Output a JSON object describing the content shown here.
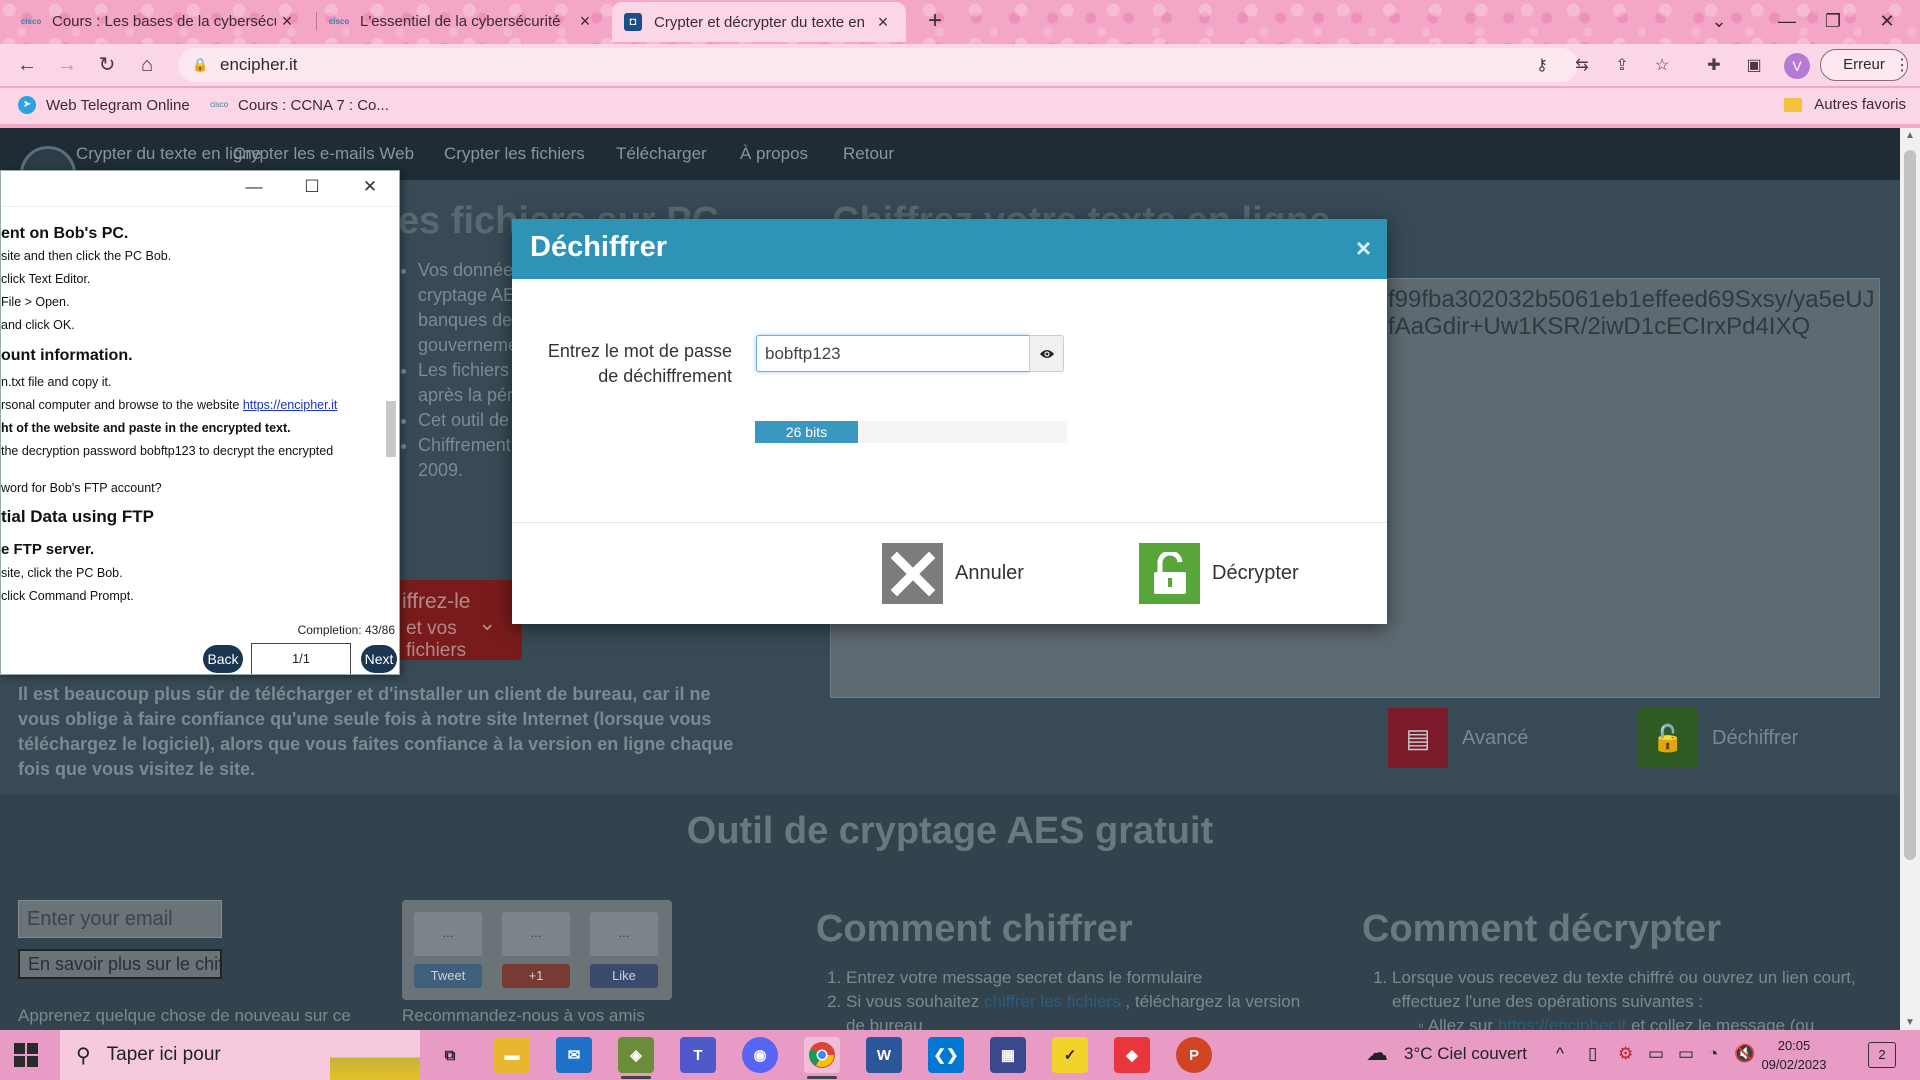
{
  "browser": {
    "tabs": [
      {
        "title": "Cours : Les bases de la cybersécu",
        "favicon": "cisco-icon",
        "active": false
      },
      {
        "title": "L'essentiel de la cybersécurité",
        "favicon": "cisco-icon",
        "active": false
      },
      {
        "title": "Crypter et décrypter du texte en",
        "favicon": "encipher-icon",
        "active": true
      }
    ],
    "url": "encipher.it",
    "profile_initial": "V",
    "error_label": "Erreur",
    "bookmarks": [
      {
        "label": "Web Telegram Online",
        "icon": "telegram-icon"
      },
      {
        "label": "Cours : CCNA 7 : Co...",
        "icon": "cisco-icon"
      }
    ],
    "other_bookmarks": "Autres favoris"
  },
  "site": {
    "nav": [
      "Crypter du texte en ligne",
      "Crypter les e-mails Web",
      "Crypter les fichiers",
      "Télécharger",
      "À propos",
      "Retour"
    ],
    "heading_left": "es fichiers sur PC",
    "heading_right": "Chiffrez votre texte en ligne",
    "bullets": [
      "Vos donnée",
      "cryptage AE",
      "banques de",
      "gouverneme",
      "Les fichiers",
      "après la pér",
      "Cet outil de",
      "Chiffrement",
      "2009."
    ],
    "cipher_text": "f99fba302032b5061eb1effeed69Sxsy/ya5eUJfAaGdir+Uw1KSR/2iwD1cECIrxPd4IXQ",
    "cta_line1": "iffrez-le",
    "cta_line2": "et vos fichiers",
    "paragraph": "Il est beaucoup plus sûr de télécharger et d'installer un client de bureau, car il ne vous oblige à faire confiance qu'une seule fois à notre site Internet (lorsque vous téléchargez le logiciel), alors que vous faites confiance à la version en ligne chaque fois que vous visitez le site.",
    "advanced_label": "Avancé",
    "decrypt_action_label": "Déchiffrer",
    "band_title": "Outil de cryptage AES gratuit",
    "email_placeholder": "Enter your email",
    "learn_more": "En savoir plus sur le chiff",
    "learn_text": "Apprenez quelque chose de nouveau sur ce",
    "social": {
      "tweet": "Tweet",
      "plus": "+1",
      "like": "Like",
      "count": "..."
    },
    "recommend": "Recommandez-nous à vos amis",
    "how_encrypt": {
      "title": "Comment chiffrer",
      "steps": [
        "Entrez votre message secret dans le formulaire",
        "Si vous souhaitez",
        "chiffrer les fichiers",
        ", téléchargez la version",
        "de bureau"
      ]
    },
    "how_decrypt": {
      "title": "Comment décrypter",
      "steps": [
        "Lorsque vous recevez du texte chiffré ou ouvrez un lien court,",
        "effectuez l'une des opérations suivantes :",
        "Allez sur",
        "https://encipher.it",
        "et collez le message (ou"
      ]
    }
  },
  "packet_tracer": {
    "lines": [
      {
        "t": "ent on Bob's PC.",
        "k": "h"
      },
      {
        "t": "site and then click the PC Bob.",
        "k": "n"
      },
      {
        "t": "click Text Editor.",
        "k": "n"
      },
      {
        "t": "File > Open.",
        "k": "n"
      },
      {
        "t": "and click OK.",
        "k": "n"
      },
      {
        "t": "ount information.",
        "k": "h"
      },
      {
        "t": "n.txt file and copy it.",
        "k": "n"
      },
      {
        "t": "rsonal computer and browse to the website",
        "k": "n"
      },
      {
        "t": "ht of the website and paste in the encrypted text.",
        "k": "b"
      },
      {
        "t": "the decryption password bobftp123 to decrypt the encrypted",
        "k": "n"
      },
      {
        "t": "word for Bob's FTP account?",
        "k": "n"
      },
      {
        "t": "tial Data using FTP",
        "k": "h"
      },
      {
        "t": "e FTP server.",
        "k": "h"
      },
      {
        "t": "site, click the PC Bob.",
        "k": "n"
      },
      {
        "t": "click Command Prompt.",
        "k": "n"
      }
    ],
    "link_text": "https://encipher.it",
    "completion": "Completion: 43/86",
    "back": "Back",
    "page": "1/1",
    "next": "Next"
  },
  "modal": {
    "title": "Déchiffrer",
    "close": "×",
    "password_label_1": "Entrez le mot de passe",
    "password_label_2": "de déchiffrement",
    "password_value": "bobftp123",
    "strength_label": "26 bits",
    "strength_fraction": 0.33,
    "cancel_label": "Annuler",
    "decrypt_label": "Décrypter"
  },
  "taskbar": {
    "search_placeholder": "Taper ici pour",
    "weather": "3°C  Ciel couvert",
    "time": "20:05",
    "date": "09/02/2023",
    "notif_count": "2"
  },
  "colors": {
    "modal_header": "#2e93b5",
    "decrypt_green": "#58a53a",
    "cancel_gray": "#7c7c7c",
    "advanced_red": "#c9253f"
  }
}
